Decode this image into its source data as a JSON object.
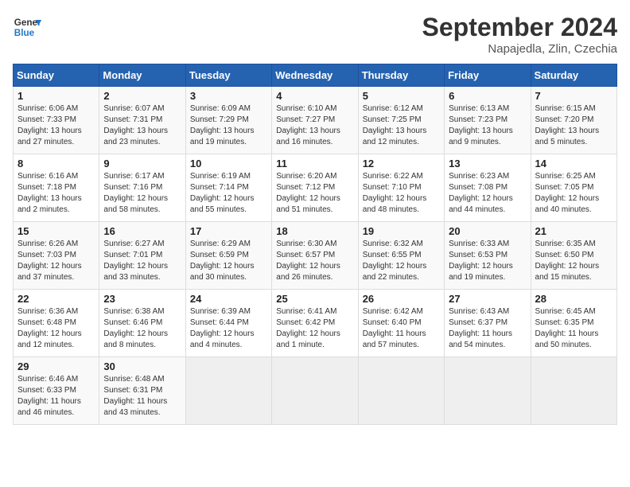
{
  "header": {
    "logo_line1": "General",
    "logo_line2": "Blue",
    "month": "September 2024",
    "location": "Napajedla, Zlin, Czechia"
  },
  "weekdays": [
    "Sunday",
    "Monday",
    "Tuesday",
    "Wednesday",
    "Thursday",
    "Friday",
    "Saturday"
  ],
  "weeks": [
    [
      {
        "day": "1",
        "info": "Sunrise: 6:06 AM\nSunset: 7:33 PM\nDaylight: 13 hours and 27 minutes."
      },
      {
        "day": "2",
        "info": "Sunrise: 6:07 AM\nSunset: 7:31 PM\nDaylight: 13 hours and 23 minutes."
      },
      {
        "day": "3",
        "info": "Sunrise: 6:09 AM\nSunset: 7:29 PM\nDaylight: 13 hours and 19 minutes."
      },
      {
        "day": "4",
        "info": "Sunrise: 6:10 AM\nSunset: 7:27 PM\nDaylight: 13 hours and 16 minutes."
      },
      {
        "day": "5",
        "info": "Sunrise: 6:12 AM\nSunset: 7:25 PM\nDaylight: 13 hours and 12 minutes."
      },
      {
        "day": "6",
        "info": "Sunrise: 6:13 AM\nSunset: 7:23 PM\nDaylight: 13 hours and 9 minutes."
      },
      {
        "day": "7",
        "info": "Sunrise: 6:15 AM\nSunset: 7:20 PM\nDaylight: 13 hours and 5 minutes."
      }
    ],
    [
      {
        "day": "8",
        "info": "Sunrise: 6:16 AM\nSunset: 7:18 PM\nDaylight: 13 hours and 2 minutes."
      },
      {
        "day": "9",
        "info": "Sunrise: 6:17 AM\nSunset: 7:16 PM\nDaylight: 12 hours and 58 minutes."
      },
      {
        "day": "10",
        "info": "Sunrise: 6:19 AM\nSunset: 7:14 PM\nDaylight: 12 hours and 55 minutes."
      },
      {
        "day": "11",
        "info": "Sunrise: 6:20 AM\nSunset: 7:12 PM\nDaylight: 12 hours and 51 minutes."
      },
      {
        "day": "12",
        "info": "Sunrise: 6:22 AM\nSunset: 7:10 PM\nDaylight: 12 hours and 48 minutes."
      },
      {
        "day": "13",
        "info": "Sunrise: 6:23 AM\nSunset: 7:08 PM\nDaylight: 12 hours and 44 minutes."
      },
      {
        "day": "14",
        "info": "Sunrise: 6:25 AM\nSunset: 7:05 PM\nDaylight: 12 hours and 40 minutes."
      }
    ],
    [
      {
        "day": "15",
        "info": "Sunrise: 6:26 AM\nSunset: 7:03 PM\nDaylight: 12 hours and 37 minutes."
      },
      {
        "day": "16",
        "info": "Sunrise: 6:27 AM\nSunset: 7:01 PM\nDaylight: 12 hours and 33 minutes."
      },
      {
        "day": "17",
        "info": "Sunrise: 6:29 AM\nSunset: 6:59 PM\nDaylight: 12 hours and 30 minutes."
      },
      {
        "day": "18",
        "info": "Sunrise: 6:30 AM\nSunset: 6:57 PM\nDaylight: 12 hours and 26 minutes."
      },
      {
        "day": "19",
        "info": "Sunrise: 6:32 AM\nSunset: 6:55 PM\nDaylight: 12 hours and 22 minutes."
      },
      {
        "day": "20",
        "info": "Sunrise: 6:33 AM\nSunset: 6:53 PM\nDaylight: 12 hours and 19 minutes."
      },
      {
        "day": "21",
        "info": "Sunrise: 6:35 AM\nSunset: 6:50 PM\nDaylight: 12 hours and 15 minutes."
      }
    ],
    [
      {
        "day": "22",
        "info": "Sunrise: 6:36 AM\nSunset: 6:48 PM\nDaylight: 12 hours and 12 minutes."
      },
      {
        "day": "23",
        "info": "Sunrise: 6:38 AM\nSunset: 6:46 PM\nDaylight: 12 hours and 8 minutes."
      },
      {
        "day": "24",
        "info": "Sunrise: 6:39 AM\nSunset: 6:44 PM\nDaylight: 12 hours and 4 minutes."
      },
      {
        "day": "25",
        "info": "Sunrise: 6:41 AM\nSunset: 6:42 PM\nDaylight: 12 hours and 1 minute."
      },
      {
        "day": "26",
        "info": "Sunrise: 6:42 AM\nSunset: 6:40 PM\nDaylight: 11 hours and 57 minutes."
      },
      {
        "day": "27",
        "info": "Sunrise: 6:43 AM\nSunset: 6:37 PM\nDaylight: 11 hours and 54 minutes."
      },
      {
        "day": "28",
        "info": "Sunrise: 6:45 AM\nSunset: 6:35 PM\nDaylight: 11 hours and 50 minutes."
      }
    ],
    [
      {
        "day": "29",
        "info": "Sunrise: 6:46 AM\nSunset: 6:33 PM\nDaylight: 11 hours and 46 minutes."
      },
      {
        "day": "30",
        "info": "Sunrise: 6:48 AM\nSunset: 6:31 PM\nDaylight: 11 hours and 43 minutes."
      },
      {
        "day": "",
        "info": ""
      },
      {
        "day": "",
        "info": ""
      },
      {
        "day": "",
        "info": ""
      },
      {
        "day": "",
        "info": ""
      },
      {
        "day": "",
        "info": ""
      }
    ]
  ]
}
